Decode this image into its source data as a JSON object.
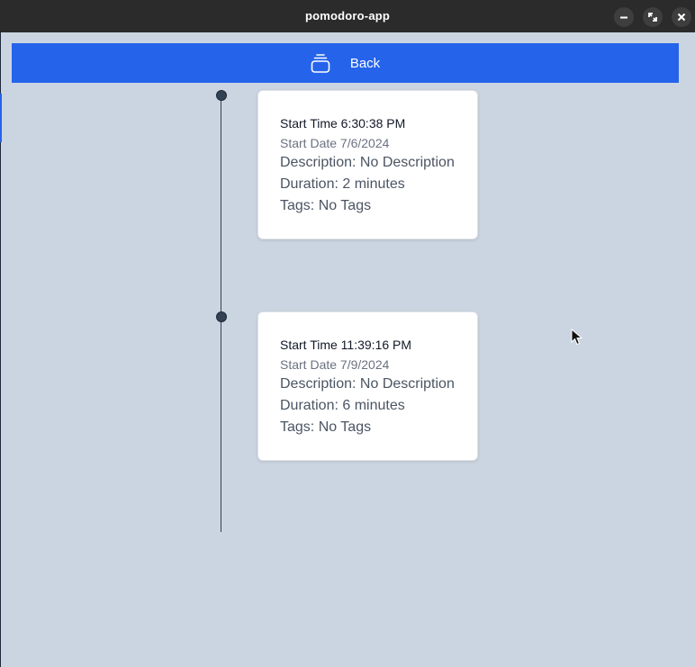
{
  "window": {
    "title": "pomodoro-app",
    "controls": [
      "minimize-icon",
      "maximize-icon",
      "close-icon"
    ]
  },
  "header": {
    "back_label": "Back",
    "back_icon": "stack-icon"
  },
  "sessions": [
    {
      "start_time": "Start Time 6:30:38 PM",
      "start_date": "Start Date 7/6/2024",
      "description": "Description: No Description",
      "duration": "Duration: 2 minutes",
      "tags": "Tags: No Tags"
    },
    {
      "start_time": "Start Time 11:39:16 PM",
      "start_date": "Start Date 7/9/2024",
      "description": "Description: No Description",
      "duration": "Duration: 6 minutes",
      "tags": "Tags: No Tags"
    }
  ],
  "colors": {
    "accent": "#2563eb",
    "background": "#cbd5e1",
    "titlebar": "#2b2b2b",
    "timeline": "#334155"
  }
}
